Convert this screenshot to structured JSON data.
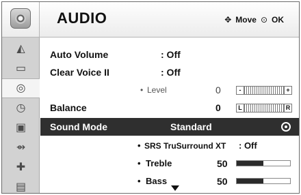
{
  "header": {
    "title": "AUDIO",
    "move_icon": "move-arrows-icon",
    "move_label": "Move",
    "ok_icon": "ok-circle-icon",
    "ok_label": "OK"
  },
  "sidebar": {
    "items": [
      {
        "icon": "picture-icon",
        "active": false
      },
      {
        "icon": "screen-icon",
        "active": false
      },
      {
        "icon": "audio-icon",
        "active": true
      },
      {
        "icon": "time-icon",
        "active": false
      },
      {
        "icon": "lock-icon",
        "active": false
      },
      {
        "icon": "input-icon",
        "active": false
      },
      {
        "icon": "support-icon",
        "active": false
      },
      {
        "icon": "media-icon",
        "active": false
      }
    ]
  },
  "menu": {
    "auto_volume": {
      "label": "Auto Volume",
      "value": ": Off"
    },
    "clear_voice": {
      "label": "Clear Voice II",
      "value": ": Off"
    },
    "level": {
      "bullet": "•",
      "label": "Level",
      "value": "0",
      "min_label": "-",
      "max_label": "+"
    },
    "balance": {
      "label": "Balance",
      "value": "0",
      "min_label": "L",
      "max_label": "R"
    },
    "sound_mode": {
      "label": "Sound Mode",
      "value": "Standard",
      "selected": true
    },
    "srs": {
      "bullet": "•",
      "label": "SRS TruSurround XT",
      "value": ": Off"
    },
    "treble": {
      "bullet": "•",
      "label": "Treble",
      "value": "50",
      "level": 0.5
    },
    "bass": {
      "bullet": "•",
      "label": "Bass",
      "value": "50",
      "level": 0.5
    }
  }
}
